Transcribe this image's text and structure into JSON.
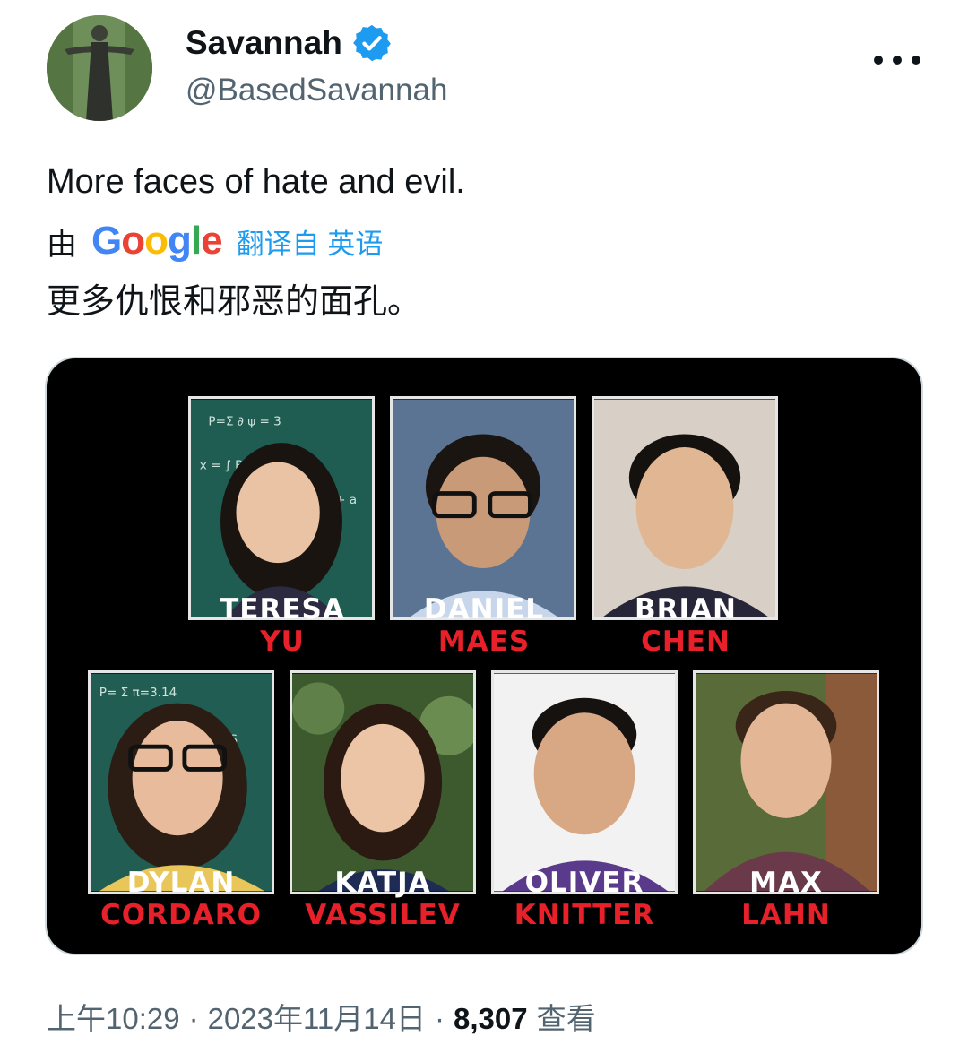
{
  "author": {
    "name": "Savannah",
    "handle": "@BasedSavannah",
    "verified": true,
    "verified_color": "#1d9bf0"
  },
  "tweet": {
    "text": "More faces of hate and evil.",
    "translation": {
      "by_label": "由",
      "provider": "Google",
      "from_label": "翻译自 英语",
      "text": "更多仇恨和邪恶的面孔。"
    }
  },
  "media": {
    "people": [
      {
        "first": "TERESA",
        "last": "YU",
        "bg": "chalkboard"
      },
      {
        "first": "DANIEL",
        "last": "MAES",
        "bg": "studio"
      },
      {
        "first": "BRIAN",
        "last": "CHEN",
        "bg": "wall"
      },
      {
        "first": "DYLAN",
        "last": "CORDARO",
        "bg": "chalkboard"
      },
      {
        "first": "KATJA",
        "last": "VASSILEV",
        "bg": "foliage"
      },
      {
        "first": "OLIVER",
        "last": "KNITTER",
        "bg": "wall"
      },
      {
        "first": "MAX",
        "last": "LAHN",
        "bg": "outdoor"
      }
    ],
    "first_name_color": "#ffffff",
    "last_name_color": "#e8202a"
  },
  "meta": {
    "time": "上午10:29",
    "separator": "·",
    "date": "2023年11月14日",
    "views_count": "8,307",
    "views_label": "查看"
  },
  "icons": {
    "more": "more-horizontal-icon",
    "verified": "verified-badge-icon"
  }
}
